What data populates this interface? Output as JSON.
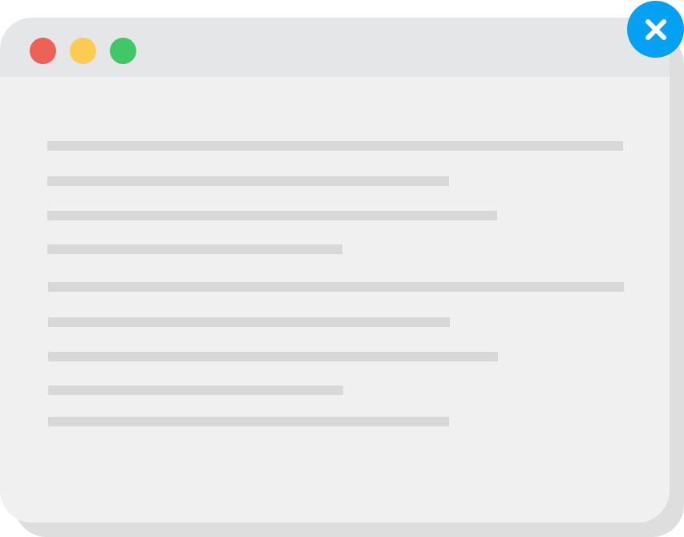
{
  "colors": {
    "close_button": "#04a0f2",
    "close_glyph": "#ffffff",
    "window_body": "#eff0ef",
    "titlebar": "#e5e6e7",
    "shadow": "#dedede",
    "text_placeholder": "#d8d8d8",
    "traffic_red": "#ee6155",
    "traffic_yellow": "#fdcb52",
    "traffic_green": "#40c768"
  },
  "window": {
    "titlebar": {
      "controls": [
        {
          "name": "close",
          "icon": "red-circle-icon"
        },
        {
          "name": "minimize",
          "icon": "yellow-circle-icon"
        },
        {
          "name": "maximize",
          "icon": "green-circle-icon"
        }
      ]
    },
    "content": {
      "placeholder_line_count": 9
    }
  },
  "overlay": {
    "close_button": {
      "icon": "close-icon"
    }
  }
}
